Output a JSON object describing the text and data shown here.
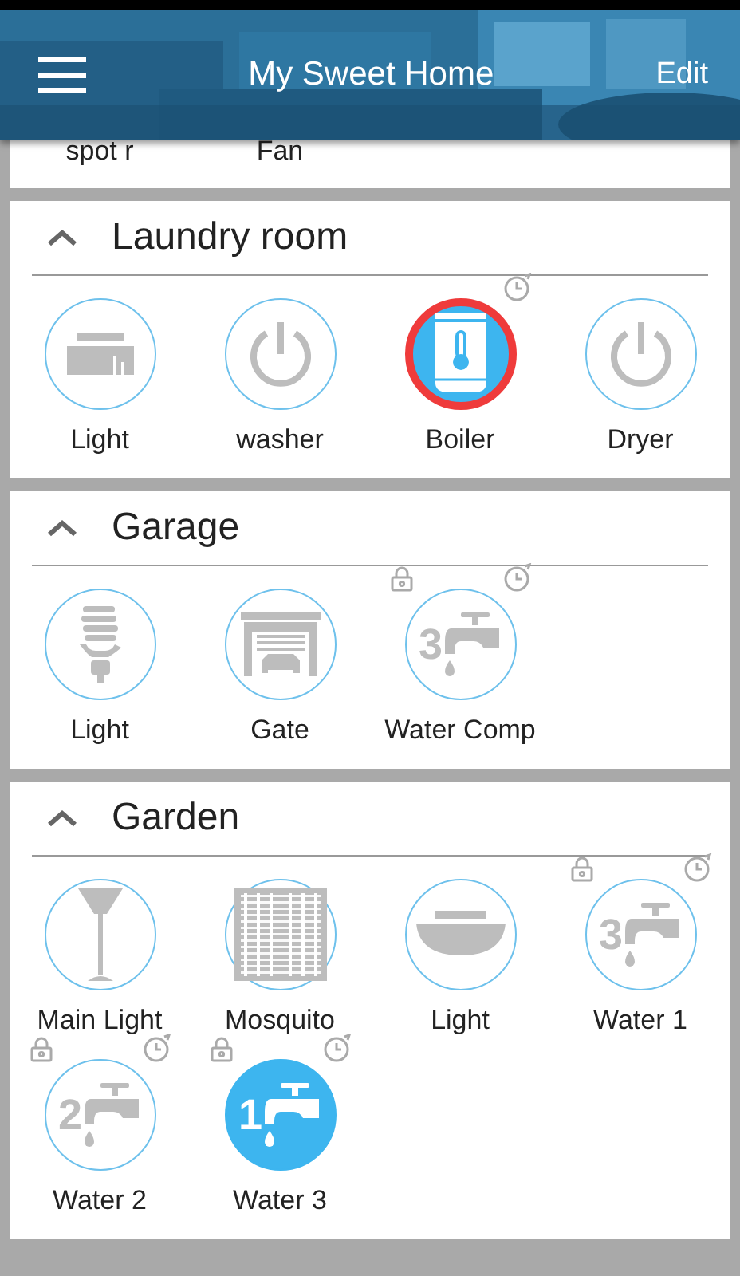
{
  "header": {
    "title": "My Sweet Home",
    "action": "Edit"
  },
  "partial_devices": [
    {
      "label": "spot r"
    },
    {
      "label": "Fan"
    }
  ],
  "rooms": [
    {
      "name": "Laundry room",
      "expanded": true,
      "devices": [
        {
          "label": "Light",
          "kind": "strip",
          "on": false,
          "alert": false,
          "locked": false,
          "timer": false
        },
        {
          "label": "washer",
          "kind": "power",
          "on": false,
          "alert": false,
          "locked": false,
          "timer": false
        },
        {
          "label": "Boiler",
          "kind": "boiler",
          "on": true,
          "alert": true,
          "locked": false,
          "timer": true
        },
        {
          "label": "Dryer",
          "kind": "power",
          "on": false,
          "alert": false,
          "locked": false,
          "timer": false
        }
      ]
    },
    {
      "name": "Garage",
      "expanded": true,
      "devices": [
        {
          "label": "Light",
          "kind": "bulb",
          "on": false,
          "alert": false,
          "locked": false,
          "timer": false
        },
        {
          "label": "Gate",
          "kind": "garage",
          "on": false,
          "alert": false,
          "locked": false,
          "timer": false
        },
        {
          "label": "Water Comp",
          "kind": "tap",
          "number": "3",
          "on": false,
          "alert": false,
          "locked": true,
          "timer": true
        }
      ]
    },
    {
      "name": "Garden",
      "expanded": true,
      "devices": [
        {
          "label": "Main Light",
          "kind": "lamp",
          "on": false,
          "alert": false,
          "locked": false,
          "timer": false
        },
        {
          "label": "Mosquito",
          "kind": "net",
          "on": false,
          "alert": false,
          "locked": false,
          "timer": false
        },
        {
          "label": "Light",
          "kind": "ceiling",
          "on": false,
          "alert": false,
          "locked": false,
          "timer": false
        },
        {
          "label": "Water 1",
          "kind": "tap",
          "number": "3",
          "on": false,
          "alert": false,
          "locked": true,
          "timer": true
        },
        {
          "label": "Water 2",
          "kind": "tap",
          "number": "2",
          "on": false,
          "alert": false,
          "locked": true,
          "timer": true
        },
        {
          "label": "Water 3",
          "kind": "tap",
          "number": "1",
          "on": true,
          "alert": false,
          "locked": true,
          "timer": true
        }
      ]
    }
  ]
}
